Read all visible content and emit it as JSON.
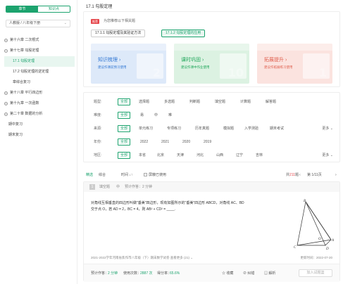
{
  "sidebar": {
    "tab_on": "章节",
    "tab_off": "知识点",
    "select_value": "人教版 / 八年级下册",
    "tree": [
      {
        "label": "第十六章 二次根式",
        "kind": "chapter",
        "pm": "+"
      },
      {
        "label": "第十七章 勾股定理",
        "kind": "chapter",
        "pm": "−"
      },
      {
        "label": "17.1 勾股定理",
        "kind": "child",
        "active": true
      },
      {
        "label": "17.2 勾股定理的逆定理",
        "kind": "child"
      },
      {
        "label": "章综合复习",
        "kind": "child"
      },
      {
        "label": "第十八章 平行四边形",
        "kind": "chapter",
        "pm": "+"
      },
      {
        "label": "第十九章 一次函数",
        "kind": "chapter",
        "pm": "+"
      },
      {
        "label": "第二十章 数据的分析",
        "kind": "chapter",
        "pm": "+"
      },
      {
        "label": "期中复习",
        "kind": "leaf"
      },
      {
        "label": "期末复习",
        "kind": "leaf"
      }
    ]
  },
  "main": {
    "title": "17.1 勾股定理",
    "recommend_tag": "推荐",
    "recommend_tip": "为您推荐以下相关题",
    "chip1": "17.1.1 勾股定理及其验证方法",
    "chip2": "17.1.2 勾股定理的应用",
    "tiles": [
      {
        "title": "知识梳理 ›",
        "sub": "建议作课前预习使用",
        "big": "2"
      },
      {
        "title": "课时巩固 ›",
        "sub": "建议作课中作业使用",
        "big": "10"
      },
      {
        "title": "拓展提升 ›",
        "sub": "建议作拓展练习使用",
        "big": "1"
      }
    ]
  },
  "filters": {
    "type": {
      "label": "题型:",
      "options": [
        "全部",
        "选择题",
        "多选题",
        "判断题",
        "填空题",
        "计算题",
        "解答题"
      ]
    },
    "difficulty": {
      "label": "难度:",
      "options": [
        "全部",
        "易",
        "中",
        "难"
      ]
    },
    "source": {
      "label": "来源:",
      "options": [
        "全部",
        "单元练习",
        "专项练习",
        "历年真题",
        "模拟题",
        "入学测验",
        "期末考试"
      ],
      "more": "更多 ⌄"
    },
    "year": {
      "label": "年份:",
      "options": [
        "全部",
        "2022",
        "2021",
        "2020",
        "2019"
      ]
    },
    "region": {
      "label": "地区:",
      "options": [
        "全部",
        "本省",
        "北京",
        "天津",
        "河北",
        "山西",
        "辽宁",
        "吉林"
      ],
      "more": "更多 ⌄"
    }
  },
  "sortbar": {
    "smart": "精选",
    "composite": "综合",
    "time": "时间 ↓↑",
    "shield": "屏蔽已使用",
    "total_prefix": "共",
    "total_num": "211",
    "total_suffix": "题",
    "page": "第 1/11页",
    "prev": "‹",
    "next": "›"
  },
  "question": {
    "num": "1",
    "type": "填空题",
    "level": "中",
    "est_time": "预计作答：2 分钟",
    "text_line1": "对角线互相垂直的四边形叫做\"垂美\"四边形，现有如图所示的\"垂美\"四边形 ABCD，对角线 AC、BD",
    "text_line2": "交于点 O，若 AD = 2，BC = 4，则 AB² + CD² = ____.",
    "source": "2021-2022学年河南省焦作市八年级（下）期末数学试卷  查看更多 (21) ⌄",
    "date": "更新时间：2022-07-20",
    "foot_time_label": "预计作答：",
    "foot_time": "2 分钟",
    "foot_used_label": "使用次数：",
    "foot_used": "2887 次",
    "foot_rate_label": "得分率：",
    "foot_rate": "65.6%",
    "collect": "收藏",
    "correct": "纠错",
    "analysis": "解析",
    "add_button": "加入试题篮",
    "points": {
      "A": "A",
      "B": "B",
      "C": "C",
      "D": "D",
      "O": "O"
    }
  },
  "colors": {
    "accent": "#1ca36e",
    "danger": "#e5484d"
  }
}
